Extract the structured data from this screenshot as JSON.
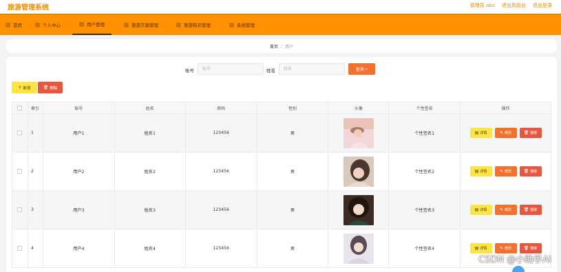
{
  "app": {
    "title": "旅游管理系统"
  },
  "top_links": [
    "管理员 abo",
    "退出到前台",
    "退出登录"
  ],
  "nav": [
    {
      "label": "首页",
      "icon": "home-icon"
    },
    {
      "label": "个人中心",
      "icon": "user-icon"
    },
    {
      "label": "用户管理",
      "icon": "users-icon",
      "active": true
    },
    {
      "label": "旅游方案管理",
      "icon": "map-icon"
    },
    {
      "label": "旅游购买管理",
      "icon": "cart-icon"
    },
    {
      "label": "系统管理",
      "icon": "gear-icon"
    }
  ],
  "breadcrumb": {
    "home": "首页",
    "sep": "/",
    "current": "用户"
  },
  "search": {
    "account_label": "账号",
    "account_placeholder": "账号",
    "name_label": "姓名",
    "name_placeholder": "姓名",
    "query_label": "查询",
    "query_icon": "search-icon"
  },
  "actions": {
    "add_label": "新增",
    "delete_label": "删除"
  },
  "table": {
    "headers": [
      "索引",
      "账号",
      "姓名",
      "密码",
      "性别",
      "头像",
      "个性签名",
      "操作"
    ],
    "rows": [
      {
        "index": "1",
        "account": "用户1",
        "name": "姓名1",
        "password": "123456",
        "sex": "男",
        "signature": "个性签名1",
        "avatar": "avatar-photo-1"
      },
      {
        "index": "2",
        "account": "用户2",
        "name": "姓名2",
        "password": "123456",
        "sex": "男",
        "signature": "个性签名2",
        "avatar": "avatar-photo-2"
      },
      {
        "index": "3",
        "account": "用户3",
        "name": "姓名3",
        "password": "123456",
        "sex": "男",
        "signature": "个性签名3",
        "avatar": "avatar-photo-3"
      },
      {
        "index": "4",
        "account": "用户4",
        "name": "姓名4",
        "password": "123456",
        "sex": "男",
        "signature": "个性签名4",
        "avatar": "avatar-photo-4"
      }
    ],
    "row_actions": {
      "detail": "详情",
      "edit": "修改",
      "delete": "删除"
    }
  },
  "watermark": "CSDN @小助手AI",
  "colors": {
    "accent": "#ff9000",
    "query": "#f0722e",
    "add": "#fde445",
    "danger": "#e6573f"
  }
}
